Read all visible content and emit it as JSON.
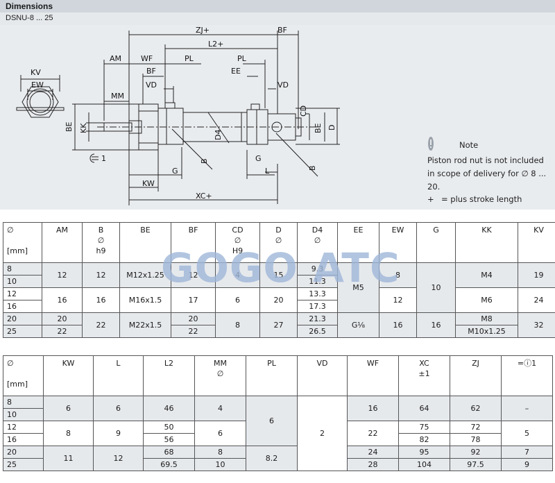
{
  "header": {
    "title": "Dimensions",
    "subtitle": "DSNU-8 ... 25"
  },
  "drawing": {
    "labels": {
      "kv": "KV",
      "ew": "EW",
      "be_left": "BE",
      "kk": "KK",
      "am": "AM",
      "wf": "WF",
      "bf_top": "BF",
      "vd_left": "VD",
      "mm": "MM",
      "zj": "ZJ+",
      "l2": "L2+",
      "pl_left": "PL",
      "pl_right": "PL",
      "bf_right": "BF",
      "ee": "EE",
      "vd_right": "VD",
      "cd": "CD",
      "be_right": "BE",
      "d": "D",
      "d4": "D4",
      "b_left": "B",
      "g_left": "G",
      "kw": "KW",
      "xc": "XC+",
      "g_right": "G",
      "l": "L",
      "b_right": "B",
      "spanner": "1"
    }
  },
  "note": {
    "title": "Note",
    "text": "Piston rod nut is not included in scope of delivery for ∅ 8 ... 20.",
    "plus_symbol": "+",
    "plus_text": "= plus stroke length"
  },
  "watermark": "GOGO ATC",
  "table1": {
    "headers": [
      {
        "l1": "∅",
        "l2": "",
        "l3": "[mm]"
      },
      {
        "l1": "AM",
        "l2": "",
        "l3": ""
      },
      {
        "l1": "B",
        "l2": "∅",
        "l3": "h9"
      },
      {
        "l1": "BE",
        "l2": "",
        "l3": ""
      },
      {
        "l1": "BF",
        "l2": "",
        "l3": ""
      },
      {
        "l1": "CD",
        "l2": "∅",
        "l3": "H9"
      },
      {
        "l1": "D",
        "l2": "∅",
        "l3": ""
      },
      {
        "l1": "D4",
        "l2": "∅",
        "l3": ""
      },
      {
        "l1": "EE",
        "l2": "",
        "l3": ""
      },
      {
        "l1": "EW",
        "l2": "",
        "l3": ""
      },
      {
        "l1": "G",
        "l2": "",
        "l3": ""
      },
      {
        "l1": "KK",
        "l2": "",
        "l3": ""
      },
      {
        "l1": "KV",
        "l2": "",
        "l3": ""
      }
    ],
    "sizes": [
      "8",
      "10",
      "12",
      "16",
      "20",
      "25"
    ],
    "am": [
      "12",
      "16",
      "20",
      "22"
    ],
    "b": [
      "12",
      "16",
      "22"
    ],
    "be": [
      "M12x1.25",
      "M16x1.5",
      "M22x1.5"
    ],
    "bf": [
      "12",
      "17",
      "20",
      "22"
    ],
    "cd": [
      "4",
      "6",
      "8"
    ],
    "d": [
      "15",
      "20",
      "27"
    ],
    "d4": [
      "9.3",
      "11.3",
      "13.3",
      "17.3",
      "21.3",
      "26.5"
    ],
    "ee": [
      "M5",
      "G⅛"
    ],
    "ew": [
      "8",
      "12",
      "16"
    ],
    "g": [
      "10",
      "16"
    ],
    "kk": [
      "M4",
      "M6",
      "M8",
      "M10x1.25"
    ],
    "kv": [
      "19",
      "24",
      "32"
    ]
  },
  "table2": {
    "headers": [
      {
        "l1": "∅",
        "l2": "",
        "l3": "[mm]"
      },
      {
        "l1": "KW",
        "l2": "",
        "l3": ""
      },
      {
        "l1": "L",
        "l2": "",
        "l3": ""
      },
      {
        "l1": "L2",
        "l2": "",
        "l3": ""
      },
      {
        "l1": "MM",
        "l2": "∅",
        "l3": ""
      },
      {
        "l1": "PL",
        "l2": "",
        "l3": ""
      },
      {
        "l1": "VD",
        "l2": "",
        "l3": ""
      },
      {
        "l1": "WF",
        "l2": "",
        "l3": ""
      },
      {
        "l1": "XC",
        "l2": "±1",
        "l3": ""
      },
      {
        "l1": "ZJ",
        "l2": "",
        "l3": ""
      },
      {
        "l1": "=ⓘ1",
        "l2": "",
        "l3": ""
      }
    ],
    "sizes": [
      "8",
      "10",
      "12",
      "16",
      "20",
      "25"
    ],
    "kw": [
      "6",
      "8",
      "11"
    ],
    "l": [
      "6",
      "9",
      "12"
    ],
    "l2": [
      "46",
      "50",
      "56",
      "68",
      "69.5"
    ],
    "mm": [
      "4",
      "6",
      "8",
      "10"
    ],
    "pl": [
      "6",
      "8.2"
    ],
    "vd": [
      "2"
    ],
    "wf": [
      "16",
      "22",
      "24",
      "28"
    ],
    "xc": [
      "64",
      "75",
      "82",
      "95",
      "104"
    ],
    "zj": [
      "62",
      "72",
      "78",
      "92",
      "97.5"
    ],
    "spanner": [
      "–",
      "5",
      "7",
      "9"
    ]
  }
}
